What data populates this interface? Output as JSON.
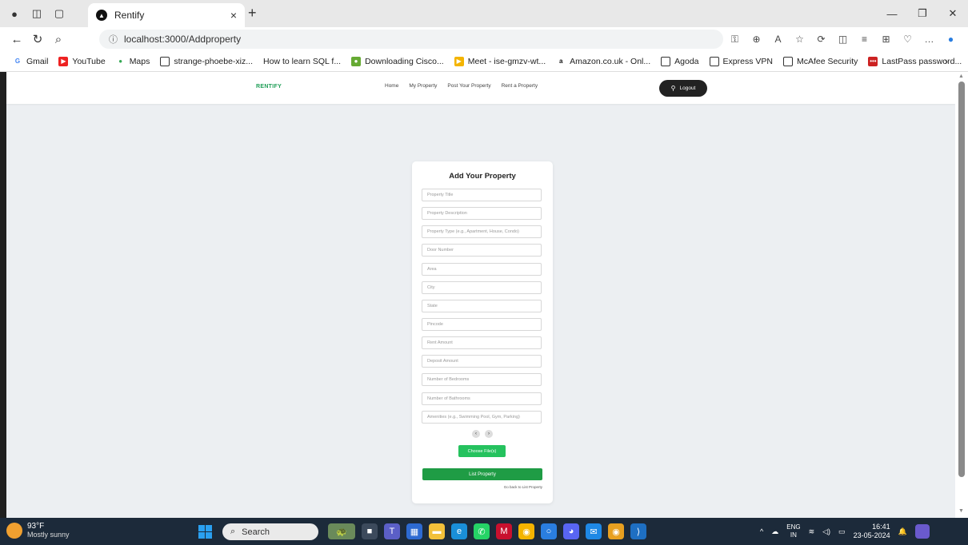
{
  "browser": {
    "tab_title": "Rentify",
    "url": "localhost:3000/Addproperty",
    "bookmarks": [
      "Gmail",
      "YouTube",
      "Maps",
      "strange-phoebe-xiz...",
      "How to learn SQL f...",
      "Downloading Cisco...",
      "Meet - ise-gmzv-wt...",
      "Amazon.co.uk - Onl...",
      "Agoda",
      "Express VPN",
      "McAfee Security",
      "LastPass password..."
    ]
  },
  "site": {
    "brand": "RENTIFY",
    "nav": [
      "Home",
      "My Property",
      "Post Your Property",
      "Rent a Property"
    ],
    "logout": "Logout"
  },
  "form": {
    "title": "Add Your Property",
    "placeholders": [
      "Property Title",
      "Property Description",
      "Property Type (e.g., Apartment, House, Condo)",
      "Door Number",
      "Area",
      "City",
      "State",
      "Pincode",
      "Rent Amount",
      "Deposit Amount",
      "Number of Bedrooms",
      "Number of Bathrooms",
      "Amenities (e.g., Swimming Pool, Gym, Parking)"
    ],
    "choose_files": "Choose File(s)",
    "submit": "List Property",
    "go_back": "Go back to List Property"
  },
  "taskbar": {
    "temp": "93°F",
    "weather": "Mostly sunny",
    "search": "Search",
    "lang1": "ENG",
    "lang2": "IN",
    "time": "16:41",
    "date": "23-05-2024"
  }
}
